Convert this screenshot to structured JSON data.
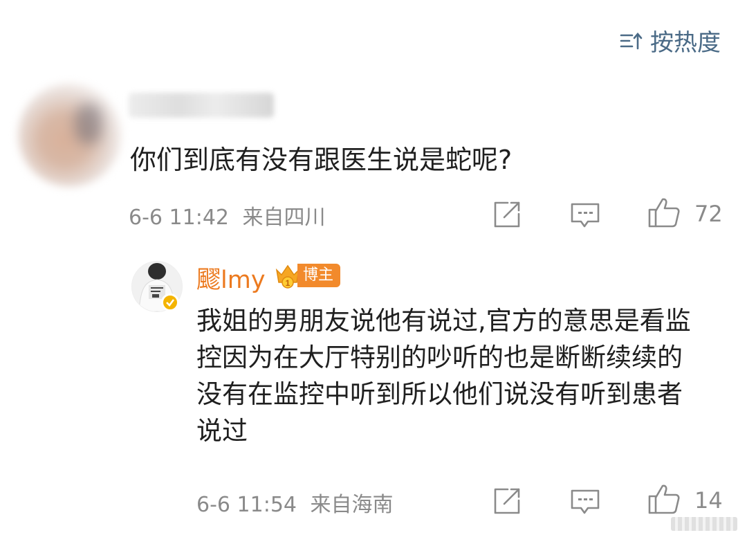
{
  "sort": {
    "label": "按热度",
    "icon": "sort-icon",
    "color": "#4a6a86"
  },
  "comment": {
    "text": "你们到底有没有跟医生说是蛇呢?",
    "time": "6-6 11:42",
    "location": "来自四川",
    "likes": "72"
  },
  "reply": {
    "username": "飂lmy",
    "badge_label": "博主",
    "badge_level": "1",
    "text": "我姐的男朋友说他有说过,官方的意思是看监控因为在大厅特别的吵听的也是断断续续的没有在监控中听到所以他们说没有听到患者说过",
    "time": "6-6 11:54",
    "location": "来自海南",
    "likes": "14",
    "name_color": "#ec7a1f",
    "badge_color": "#f28a2c"
  }
}
